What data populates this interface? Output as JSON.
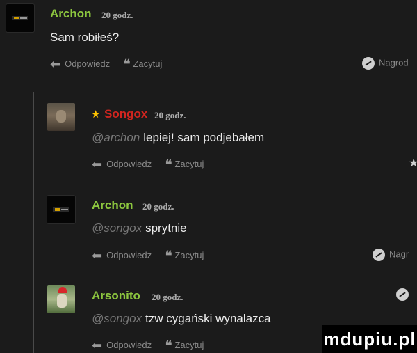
{
  "comments": [
    {
      "author": "Archon",
      "time": "20 godz.",
      "mention": "",
      "text": "Sam robiłeś?",
      "reply_label": "Odpowiedz",
      "quote_label": "Zacytuj",
      "reward_label": "Nagrod"
    },
    {
      "author": "Songox",
      "time": "20 godz.",
      "mention": "@archon",
      "text": "lepiej! sam podjebałem",
      "reply_label": "Odpowiedz",
      "quote_label": "Zacytuj"
    },
    {
      "author": "Archon",
      "time": "20 godz.",
      "mention": "@songox",
      "text": "sprytnie",
      "reply_label": "Odpowiedz",
      "quote_label": "Zacytuj",
      "reward_label": "Nagr"
    },
    {
      "author": "Arsonito",
      "time": "20 godz.",
      "mention": "@songox",
      "text": "tzw cygański wynalazca",
      "reply_label": "Odpowiedz",
      "quote_label": "Zacytuj"
    }
  ],
  "watermark": "mdupiu.pl",
  "colors": {
    "background": "#1b1b1b",
    "author_green": "#8dc73f",
    "author_red": "#d0251f",
    "star": "#ffc400"
  },
  "icons": [
    "reply-arrow-icon",
    "quote-icon",
    "report-icon",
    "star-icon"
  ]
}
